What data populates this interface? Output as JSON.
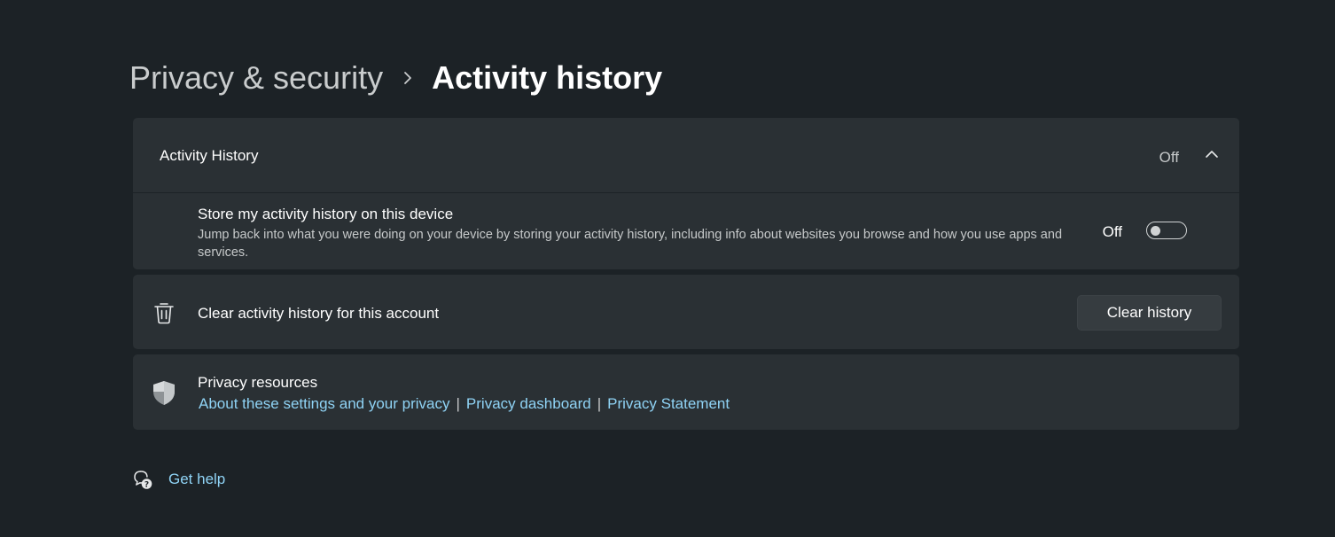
{
  "breadcrumb": {
    "parent": "Privacy & security",
    "current": "Activity history"
  },
  "activity_history": {
    "title": "Activity History",
    "status": "Off",
    "store_setting": {
      "title": "Store my activity history on this device",
      "description": "Jump back into what you were doing on your device by storing your activity history, including info about websites you browse and how you use apps and services.",
      "state_label": "Off",
      "enabled": false
    }
  },
  "clear_history": {
    "label": "Clear activity history for this account",
    "button_label": "Clear history",
    "icon": "trash-icon"
  },
  "privacy_resources": {
    "title": "Privacy resources",
    "icon": "shield-icon",
    "links": [
      "About these settings and your privacy",
      "Privacy dashboard",
      "Privacy Statement"
    ],
    "separator": "|"
  },
  "help": {
    "label": "Get help",
    "icon": "help-icon"
  },
  "colors": {
    "background": "#1c2226",
    "card": "#2a3034",
    "link": "#8fd3f5"
  }
}
